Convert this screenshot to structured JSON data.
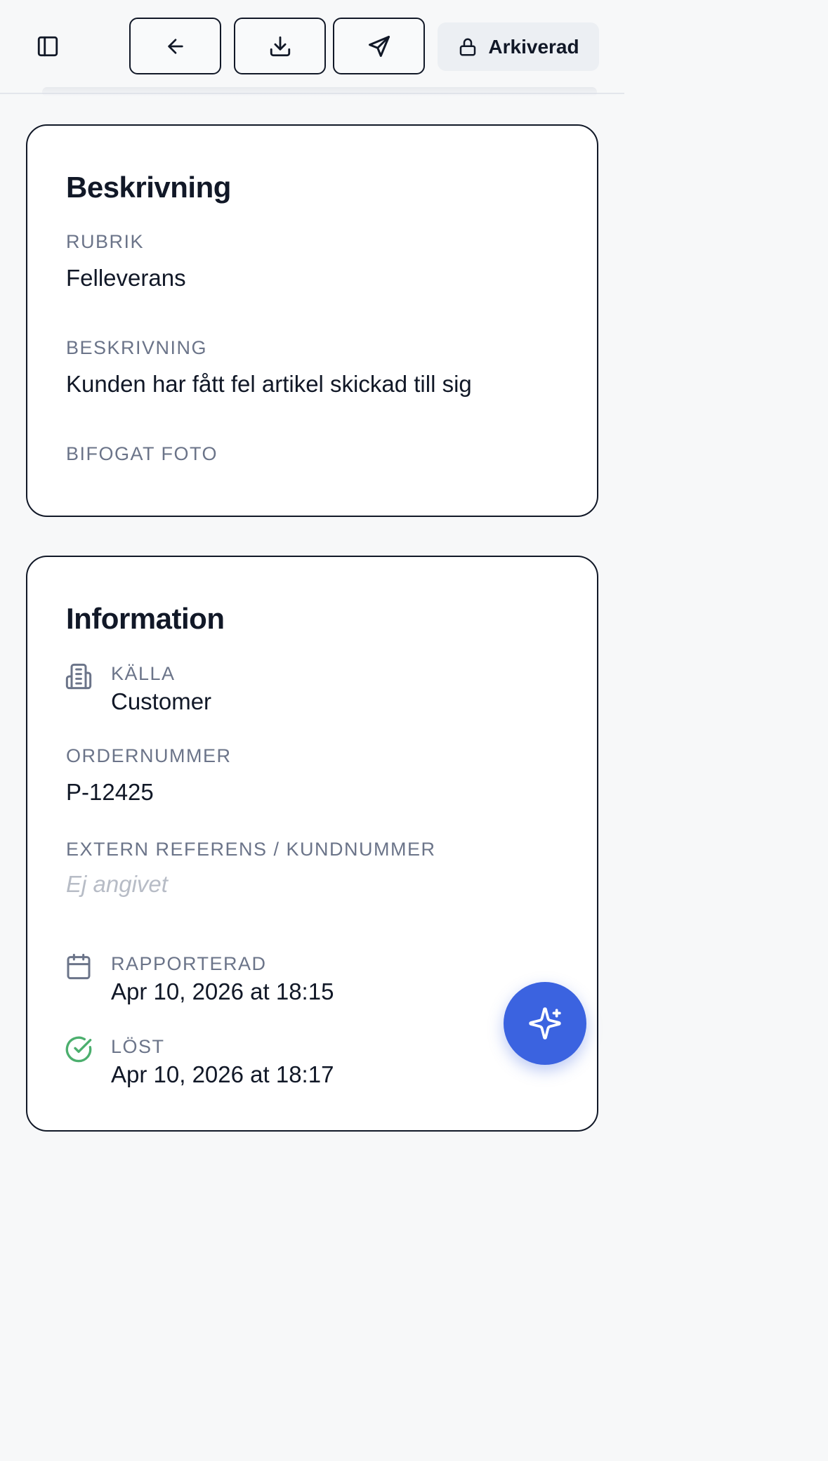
{
  "toolbar": {
    "status_label": "Arkiverad"
  },
  "description_card": {
    "title": "Beskrivning",
    "rubrik_label": "RUBRIK",
    "rubrik_value": "Felleverans",
    "beskrivning_label": "BESKRIVNING",
    "beskrivning_value": "Kunden har fått fel artikel skickad till sig",
    "photo_label": "BIFOGAT FOTO"
  },
  "info_card": {
    "title": "Information",
    "source_label": "KÄLLA",
    "source_value": "Customer",
    "order_label": "ORDERNUMMER",
    "order_value": "P-12425",
    "external_ref_label": "EXTERN REFERENS / KUNDNUMMER",
    "external_ref_placeholder": "Ej angivet",
    "reported_label": "RAPPORTERAD",
    "reported_value": "Apr 10, 2026 at 18:15",
    "resolved_label": "LÖST",
    "resolved_value": "Apr 10, 2026 at 18:17"
  },
  "icons": {
    "sidebar": "sidebar-toggle-icon",
    "back": "arrow-left-icon",
    "download": "download-icon",
    "send": "send-icon",
    "lock": "lock-icon",
    "building": "building-icon",
    "calendar": "calendar-icon",
    "check": "check-circle-icon",
    "ai": "sparkles-icon"
  },
  "colors": {
    "accent": "#3b63e0",
    "success": "#4caf6e",
    "muted_label": "#6b7489"
  }
}
